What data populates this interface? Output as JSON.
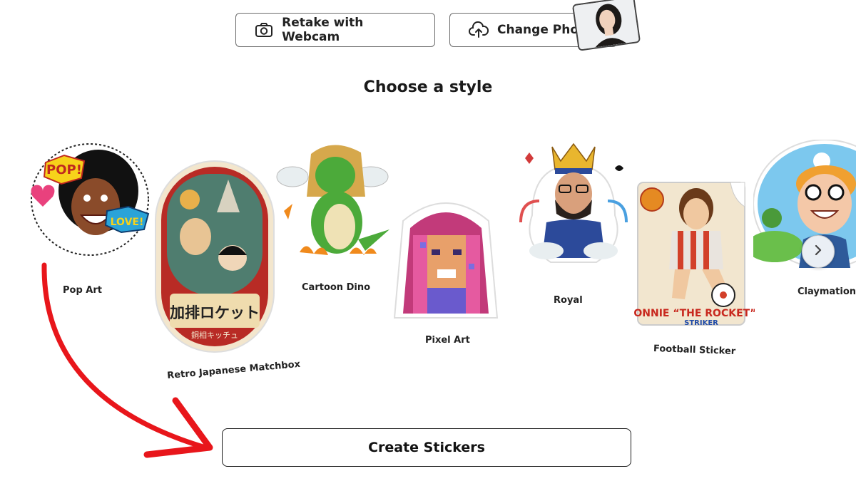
{
  "toolbar": {
    "retake_label": "Retake with Webcam",
    "change_label": "Change Photo"
  },
  "section": {
    "title": "Choose a style"
  },
  "styles": [
    {
      "label": "Pop Art",
      "badge1": "POP!",
      "badge2": "LOVE!"
    },
    {
      "label": "Retro Japanese Matchbox",
      "art_text": "加排ロケット",
      "art_subtext": "銅相キッチュ"
    },
    {
      "label": "Cartoon Dino"
    },
    {
      "label": "Pixel Art"
    },
    {
      "label": "Royal"
    },
    {
      "label": "Football Sticker",
      "art_name": "RONNIE “THE ROCKET”",
      "art_role": "STRIKER"
    },
    {
      "label": "Claymation"
    }
  ],
  "actions": {
    "create_label": "Create Stickers"
  },
  "icons": {
    "retake": "camera-icon",
    "change": "upload-cloud-icon",
    "next": "chevron-right-icon"
  },
  "colors": {
    "annotation_arrow": "#e8161b",
    "button_border": "#6b6b6b"
  }
}
